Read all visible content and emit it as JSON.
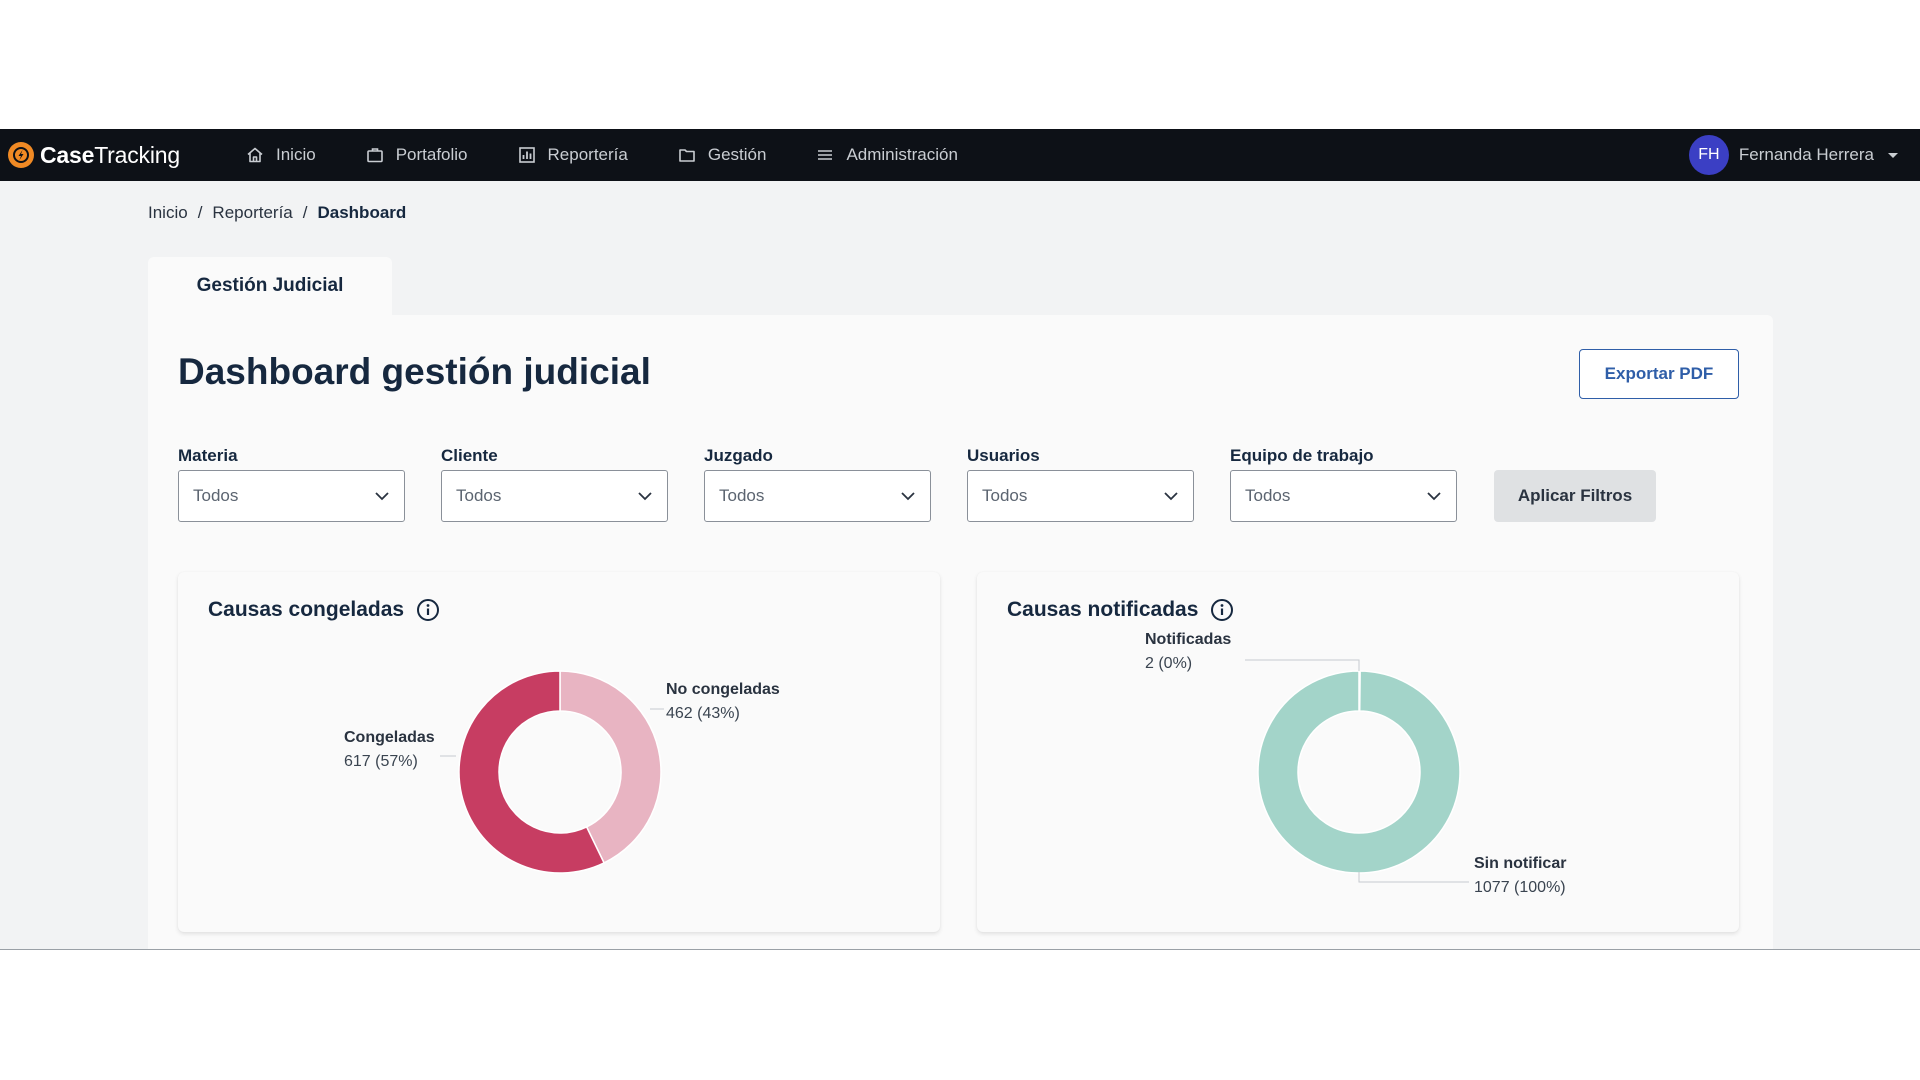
{
  "nav": {
    "brand_bold": "Case",
    "brand_light": "Tracking",
    "links": [
      {
        "label": "Inicio",
        "icon": "home-icon"
      },
      {
        "label": "Portafolio",
        "icon": "briefcase-icon"
      },
      {
        "label": "Reportería",
        "icon": "bar-chart-icon"
      },
      {
        "label": "Gestión",
        "icon": "folder-icon"
      },
      {
        "label": "Administración",
        "icon": "menu-icon"
      }
    ],
    "user": {
      "initials": "FH",
      "name": "Fernanda Herrera"
    }
  },
  "breadcrumb": [
    "Inicio",
    "Reportería",
    "Dashboard"
  ],
  "tab": "Gestión Judicial",
  "page": {
    "title": "Dashboard gestión judicial",
    "export_label": "Exportar PDF"
  },
  "filters": [
    {
      "label": "Materia",
      "value": "Todos"
    },
    {
      "label": "Cliente",
      "value": "Todos"
    },
    {
      "label": "Juzgado",
      "value": "Todos"
    },
    {
      "label": "Usuarios",
      "value": "Todos"
    },
    {
      "label": "Equipo de trabajo",
      "value": "Todos"
    }
  ],
  "apply_label": "Aplicar Filtros",
  "chart_data": [
    {
      "type": "pie",
      "title": "Causas congeladas",
      "slices": [
        {
          "name": "No congeladas",
          "value": 462,
          "label": "462 (43%)",
          "color": "#e8b4c2"
        },
        {
          "name": "Congeladas",
          "value": 617,
          "label": "617 (57%)",
          "color": "#c73d62"
        }
      ]
    },
    {
      "type": "pie",
      "title": "Causas notificadas",
      "slices": [
        {
          "name": "Notificadas",
          "value": 2,
          "label": "2 (0%)",
          "color": "#8fcfc0"
        },
        {
          "name": "Sin notificar",
          "value": 1077,
          "label": "1077 (100%)",
          "color": "#a3d4c9"
        }
      ]
    }
  ]
}
